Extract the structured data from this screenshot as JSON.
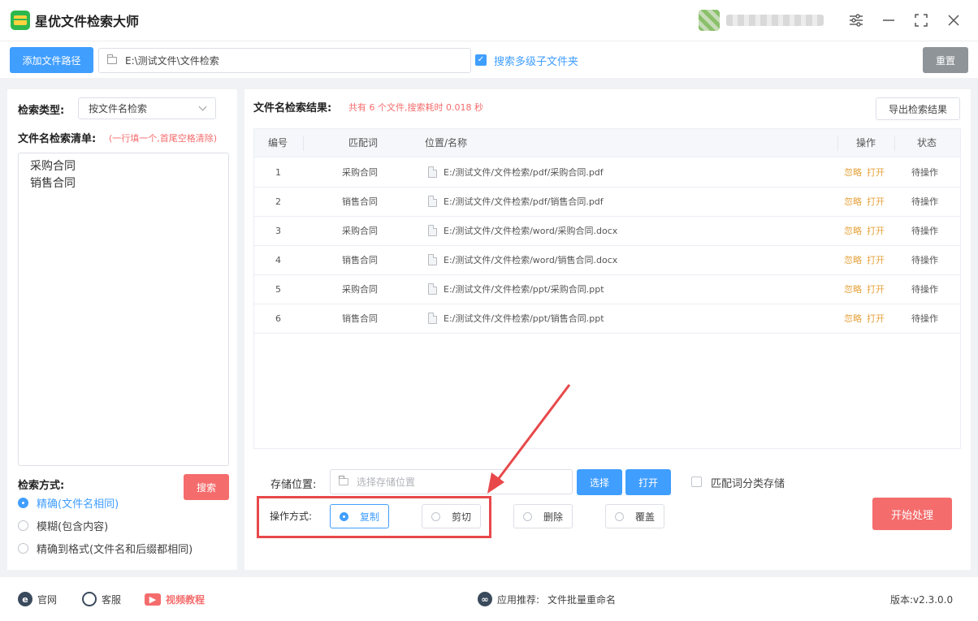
{
  "titlebar": {
    "title": "星优文件检索大师",
    "icons": {
      "settings": "sliders-icon",
      "minimize": "minimize-icon",
      "maximize": "maximize-icon",
      "close": "close-icon"
    }
  },
  "toolbar": {
    "add_path_label": "添加文件路径",
    "path_value": "E:\\测试文件\\文件检索",
    "subfolder_label": "搜索多级子文件夹",
    "subfolder_checked": true,
    "reset_label": "重置"
  },
  "left": {
    "search_type_label": "检索类型:",
    "search_type_value": "按文件名检索",
    "list_label": "文件名检索清单:",
    "list_hint": "(一行填一个,首尾空格清除)",
    "list_items": [
      "采购合同",
      "销售合同"
    ],
    "method_label": "检索方式:",
    "methods": [
      {
        "label": "精确(文件名相同)",
        "selected": true
      },
      {
        "label": "模糊(包含内容)",
        "selected": false
      },
      {
        "label": "精确到格式(文件名和后缀都相同)",
        "selected": false
      }
    ],
    "search_button": "搜索"
  },
  "results": {
    "title": "文件名检索结果:",
    "summary": "共有 6 个文件,搜索耗时 0.018 秒",
    "export_label": "导出检索结果",
    "columns": [
      "编号",
      "匹配词",
      "位置/名称",
      "操作",
      "状态"
    ],
    "rows": [
      {
        "no": "1",
        "keyword": "采购合同",
        "path": "E:/测试文件/文件检索/pdf/采购合同.pdf",
        "ignore": "忽略",
        "open": "打开",
        "status": "待操作"
      },
      {
        "no": "2",
        "keyword": "销售合同",
        "path": "E:/测试文件/文件检索/pdf/销售合同.pdf",
        "ignore": "忽略",
        "open": "打开",
        "status": "待操作"
      },
      {
        "no": "3",
        "keyword": "采购合同",
        "path": "E:/测试文件/文件检索/word/采购合同.docx",
        "ignore": "忽略",
        "open": "打开",
        "status": "待操作"
      },
      {
        "no": "4",
        "keyword": "销售合同",
        "path": "E:/测试文件/文件检索/word/销售合同.docx",
        "ignore": "忽略",
        "open": "打开",
        "status": "待操作"
      },
      {
        "no": "5",
        "keyword": "采购合同",
        "path": "E:/测试文件/文件检索/ppt/采购合同.ppt",
        "ignore": "忽略",
        "open": "打开",
        "status": "待操作"
      },
      {
        "no": "6",
        "keyword": "销售合同",
        "path": "E:/测试文件/文件检索/ppt/销售合同.ppt",
        "ignore": "忽略",
        "open": "打开",
        "status": "待操作"
      }
    ]
  },
  "bottom": {
    "storage_label": "存储位置:",
    "storage_placeholder": "选择存储位置",
    "choose_label": "选择",
    "open_label": "打开",
    "classify_label": "匹配词分类存储",
    "classify_checked": false,
    "operation_label": "操作方式:",
    "operations": [
      {
        "label": "复制",
        "selected": true
      },
      {
        "label": "剪切",
        "selected": false
      },
      {
        "label": "删除",
        "selected": false
      },
      {
        "label": "覆盖",
        "selected": false
      }
    ],
    "start_label": "开始处理",
    "highlight_color": "#e8484a"
  },
  "status": {
    "website": "官网",
    "support": "客服",
    "video": "视频教程",
    "recommend_label": "应用推荐:",
    "recommend_app": "文件批量重命名",
    "version": "版本:v2.3.0.0"
  },
  "colors": {
    "primary": "#409eff",
    "danger": "#f56c6c",
    "warning": "#e6a23c",
    "neutral": "#8f9499"
  }
}
